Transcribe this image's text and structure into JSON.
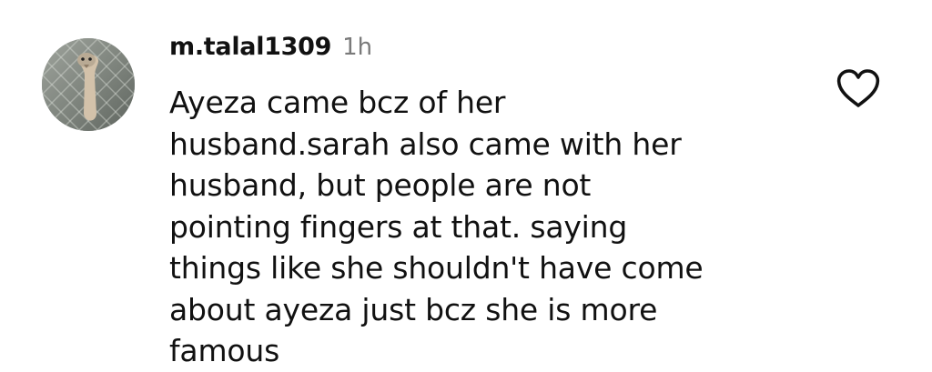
{
  "comment": {
    "username": "m.talal1309",
    "timestamp": "1h",
    "text": "Ayeza came bcz of her\nhusband.sarah also came with her\nhusband, but people are not\npointing fingers at that. saying\nthings like she shouldn't have come\nabout ayeza just bcz she is more\nfamous",
    "like_icon": "heart-outline-icon",
    "avatar_icon": "ostrich-photo-avatar"
  },
  "colors": {
    "text": "#111111",
    "timestamp": "#7a7a7a",
    "background": "#ffffff"
  }
}
